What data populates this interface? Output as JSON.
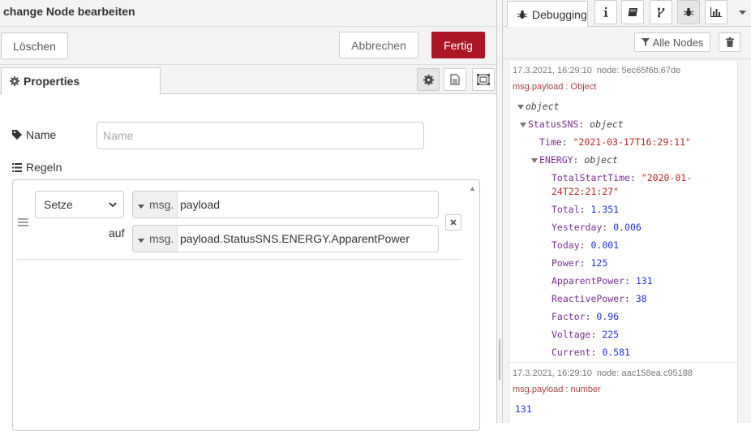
{
  "tray": {
    "title": "change Node bearbeiten",
    "delete_label": "Löschen",
    "cancel_label": "Abbrechen",
    "done_label": "Fertig",
    "tab_properties": "Properties",
    "name_label": "Name",
    "name_placeholder": "Name",
    "name_value": "",
    "rules_label": "Regeln",
    "rule": {
      "action": "Setze",
      "target_type": "msg.",
      "target_value": "payload",
      "to_label": "auf",
      "source_type": "msg.",
      "source_value": "payload.StatusSNS.ENERGY.ApparentPower"
    }
  },
  "sidebar": {
    "debug_tab_label": "Debugging",
    "filter_label": "Alle Nodes",
    "messages": [
      {
        "timestamp": "17.3.2021, 16:29:10",
        "node": "node: 5ec65f6b.67de",
        "topic": "msg.payload : Object",
        "tree": {
          "root": "object",
          "status_key": "StatusSNS",
          "status_type": "object",
          "time_key": "Time",
          "time_val": "\"2021-03-17T16:29:11\"",
          "energy_key": "ENERGY",
          "energy_type": "object",
          "tst_key": "TotalStartTime",
          "tst_val_1": "\"2020-01-",
          "tst_val_2": "24T22:21:27\"",
          "fields": [
            {
              "k": "Total",
              "v": "1.351"
            },
            {
              "k": "Yesterday",
              "v": "0.006"
            },
            {
              "k": "Today",
              "v": "0.001"
            },
            {
              "k": "Power",
              "v": "125"
            },
            {
              "k": "ApparentPower",
              "v": "131"
            },
            {
              "k": "ReactivePower",
              "v": "38"
            },
            {
              "k": "Factor",
              "v": "0.96"
            },
            {
              "k": "Voltage",
              "v": "225"
            },
            {
              "k": "Current",
              "v": "0.581"
            }
          ]
        }
      },
      {
        "timestamp": "17.3.2021, 16:29:10",
        "node": "node: aac158ea.c95188",
        "topic": "msg.payload : number",
        "value": "131"
      }
    ]
  },
  "colors": {
    "primary_button": "#ad1625",
    "string_value": "#b72828",
    "number_value": "#2033d6",
    "key": "#792e90"
  }
}
